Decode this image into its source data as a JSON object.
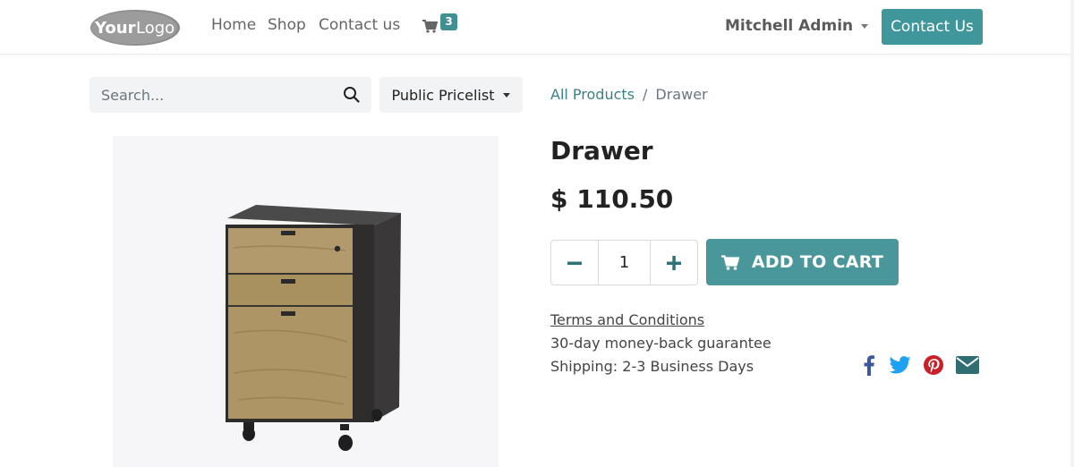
{
  "header": {
    "logo_text": "YourLogo",
    "nav": {
      "home": "Home",
      "shop": "Shop",
      "contact": "Contact us"
    },
    "cart_count": "3",
    "user_name": "Mitchell Admin",
    "contact_button": "Contact Us"
  },
  "search": {
    "placeholder": "Search..."
  },
  "pricelist": {
    "label": "Public Pricelist"
  },
  "breadcrumb": {
    "parent": "All Products",
    "separator": "/",
    "current": "Drawer"
  },
  "product": {
    "name": "Drawer",
    "price": "$ 110.50",
    "quantity": "1",
    "add_to_cart": "ADD TO CART",
    "terms": "Terms and Conditions",
    "guarantee": "30-day money-back guarantee",
    "shipping": "Shipping: 2-3 Business Days"
  },
  "social": [
    "facebook-icon",
    "twitter-icon",
    "pinterest-icon",
    "envelope-icon"
  ],
  "colors": {
    "primary": "#4a979b",
    "link": "#3a8185",
    "facebook": "#3b5998",
    "twitter": "#1da1f2",
    "pinterest": "#cb2027",
    "email": "#2f6f73"
  }
}
